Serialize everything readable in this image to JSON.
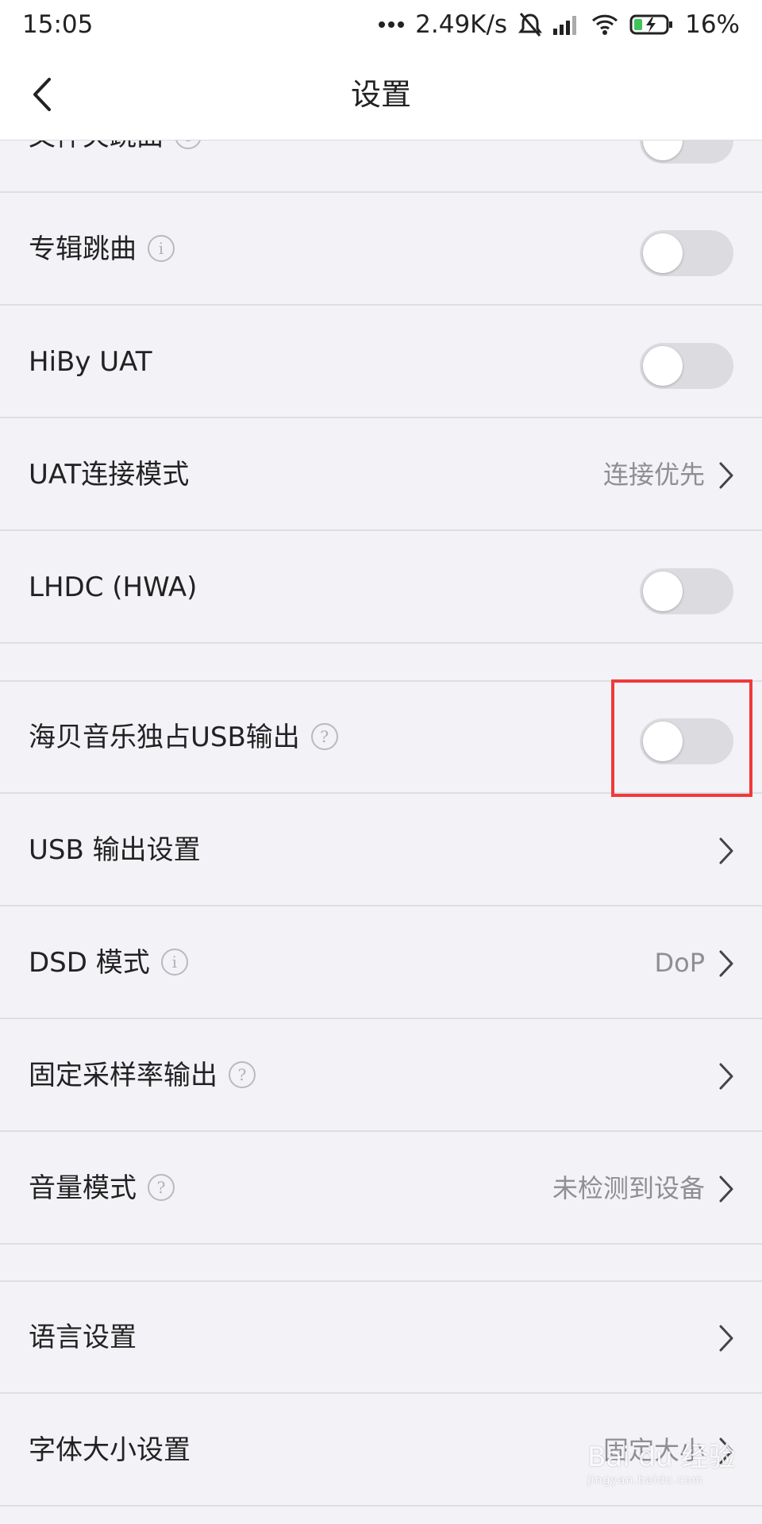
{
  "status_bar": {
    "time": "15:05",
    "network_speed": "2.49K/s",
    "battery": "16%",
    "icons": [
      "more-dots-icon",
      "mute-bell-icon",
      "signal-icon",
      "wifi-icon",
      "battery-charging-icon"
    ]
  },
  "header": {
    "title": "设置",
    "back_icon": "chevron-left-icon"
  },
  "rows": {
    "folder_skip": {
      "label": "文件夹跳曲",
      "toggle_on": false
    },
    "album_skip": {
      "label": "专辑跳曲",
      "toggle_on": false
    },
    "hiby_uat": {
      "label": "HiBy UAT",
      "toggle_on": false
    },
    "uat_mode": {
      "label": "UAT连接模式",
      "value": "连接优先"
    },
    "lhdc": {
      "label": "LHDC (HWA)",
      "toggle_on": false
    },
    "usb_exclusive": {
      "label": "海贝音乐独占USB输出",
      "toggle_on": false
    },
    "usb_output": {
      "label": "USB 输出设置"
    },
    "dsd_mode": {
      "label": "DSD 模式",
      "value": "DoP"
    },
    "fixed_rate": {
      "label": "固定采样率输出"
    },
    "volume_mode": {
      "label": "音量模式",
      "value": "未检测到设备"
    },
    "language": {
      "label": "语言设置"
    },
    "font_size": {
      "label": "字体大小设置",
      "value": "固定大小"
    }
  },
  "watermark": {
    "text": "Bai du 经验",
    "subtext": "jingyan.baidu.com"
  },
  "colors": {
    "background": "#f2f2f7",
    "toggle_off": "#dcdce0",
    "highlight": "#f03a3a",
    "secondary_text": "#8e8e93"
  }
}
